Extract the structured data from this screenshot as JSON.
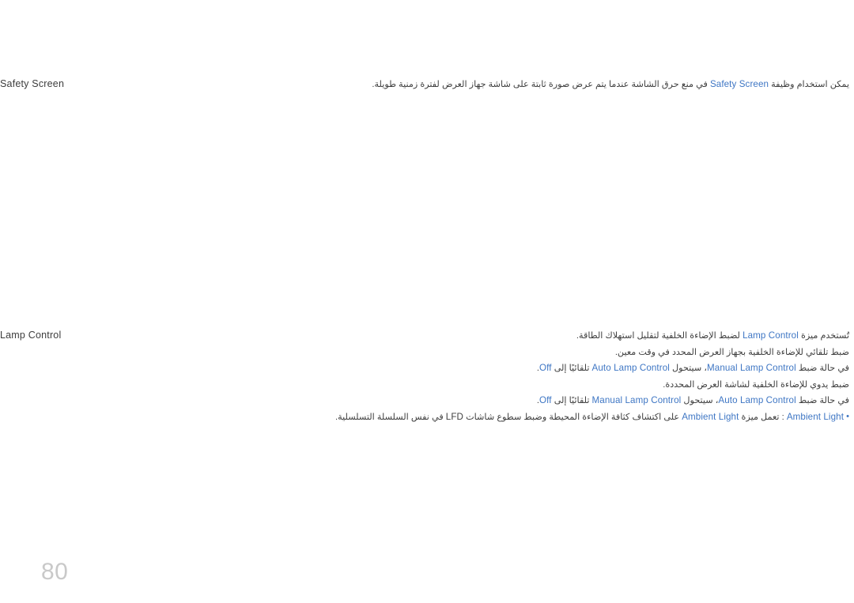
{
  "document": {
    "language": "ar",
    "direction": "rtl",
    "page_number": "80",
    "accent_color": "#3e76c4",
    "text_color": "#3f3f3f",
    "page_number_color": "#c9c9c9",
    "background_color": "#ffffff"
  },
  "sections": [
    {
      "id": "safety-screen",
      "heading": "Safety Screen",
      "lines": [
        {
          "id": "safety-screen-description",
          "segments": [
            {
              "type": "ar",
              "text": "يمكن استخدام وظيفة "
            },
            {
              "type": "en-accent",
              "text": "Safety Screen"
            },
            {
              "type": "ar",
              "text": " في منع حرق الشاشة عندما يتم عرض صورة ثابتة على شاشة جهاز العرض لفترة زمنية طويلة."
            }
          ]
        }
      ]
    },
    {
      "id": "lamp-control",
      "heading": "Lamp Control",
      "lines": [
        {
          "id": "lamp-control-description",
          "segments": [
            {
              "type": "ar",
              "text": "تُستخدم ميزة "
            },
            {
              "type": "en-accent",
              "text": "Lamp Control"
            },
            {
              "type": "ar",
              "text": " لضبط الإضاءة الخلفية لتقليل استهلاك الطاقة."
            }
          ]
        },
        {
          "id": "auto-lamp-control-description",
          "segments": [
            {
              "type": "ar",
              "text": "ضبط تلقائي للإضاءة الخلفية بجهاز العرض المحدد في وقت معين."
            }
          ]
        },
        {
          "id": "manual-switches-auto-off",
          "segments": [
            {
              "type": "ar",
              "text": "في حالة ضبط "
            },
            {
              "type": "en-accent",
              "text": "Manual Lamp Control"
            },
            {
              "type": "ar",
              "text": "، سيتحول "
            },
            {
              "type": "en-accent",
              "text": "Auto Lamp Control"
            },
            {
              "type": "ar",
              "text": " تلقائيًا إلى "
            },
            {
              "type": "en-accent",
              "text": "Off"
            },
            {
              "type": "ar",
              "text": "."
            }
          ]
        },
        {
          "id": "manual-lamp-control-description",
          "segments": [
            {
              "type": "ar",
              "text": "ضبط يدوي للإضاءة الخلفية لشاشة العرض المحددة."
            }
          ]
        },
        {
          "id": "auto-switches-manual-off",
          "segments": [
            {
              "type": "ar",
              "text": "في حالة ضبط "
            },
            {
              "type": "en-accent",
              "text": "Auto Lamp Control"
            },
            {
              "type": "ar",
              "text": "، سيتحول "
            },
            {
              "type": "en-accent",
              "text": "Manual Lamp Control"
            },
            {
              "type": "ar",
              "text": " تلقائيًا إلى "
            },
            {
              "type": "en-accent",
              "text": "Off"
            },
            {
              "type": "ar",
              "text": "."
            }
          ]
        },
        {
          "id": "ambient-light-bullet",
          "bullet": "•",
          "segments": [
            {
              "type": "en-accent",
              "text": "Ambient Light"
            },
            {
              "type": "ar",
              "text": " : تعمل ميزة "
            },
            {
              "type": "en-accent",
              "text": "Ambient Light"
            },
            {
              "type": "ar",
              "text": " على اكتشاف كثافة الإضاءة المحيطة وضبط سطوع شاشات "
            },
            {
              "type": "en-plain",
              "text": "LFD"
            },
            {
              "type": "ar",
              "text": " في نفس السلسلة التسلسلية."
            }
          ]
        }
      ]
    }
  ]
}
